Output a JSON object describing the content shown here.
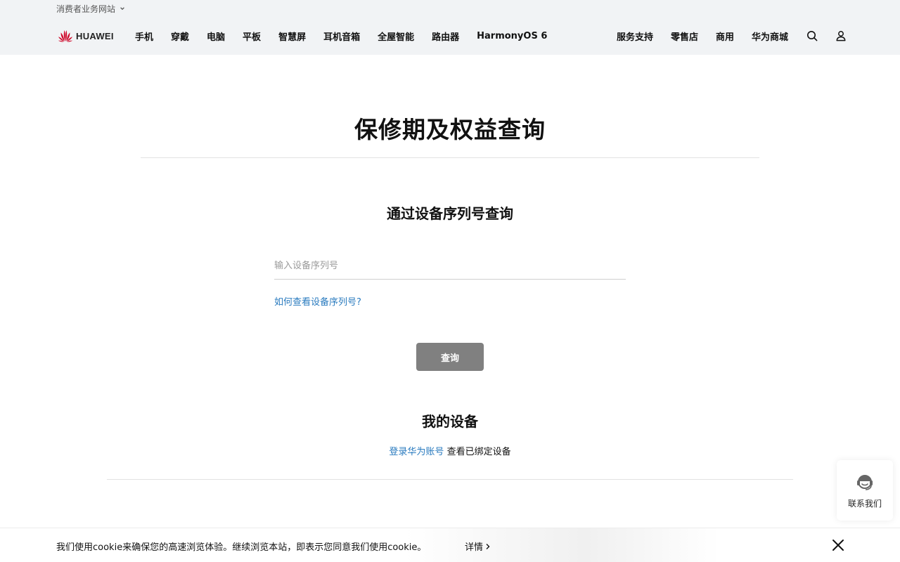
{
  "header": {
    "site_switch": "消费者业务网站",
    "logo_text": "HUAWEI",
    "nav_left": [
      "手机",
      "穿戴",
      "电脑",
      "平板",
      "智慧屏",
      "耳机音箱",
      "全屋智能",
      "路由器",
      "HarmonyOS 6"
    ],
    "nav_right": [
      "服务支持",
      "零售店",
      "商用",
      "华为商城"
    ],
    "icons": [
      "search-icon",
      "user-icon"
    ],
    "background": "#f1f3f5"
  },
  "main": {
    "page_title": "保修期及权益查询",
    "section_title": "通过设备序列号查询",
    "sn_placeholder": "输入设备序列号",
    "sn_value": "",
    "sn_help_link": "如何查看设备序列号?",
    "query_button": "查询",
    "my_devices_title": "我的设备",
    "login_link": "登录华为账号",
    "login_suffix": " 查看已绑定设备"
  },
  "contact": {
    "label": "联系我们",
    "icon": "headset-icon"
  },
  "cookie_bar": {
    "text": "我们使用cookie来确保您的高速浏览体验。继续浏览本站，即表示您同意我们使用cookie。",
    "detail": "详情",
    "close_icon": "close-icon"
  },
  "colors": {
    "link": "#2a7bbf",
    "button_disabled": "#808080",
    "brand_red": "#cf0a2c"
  }
}
